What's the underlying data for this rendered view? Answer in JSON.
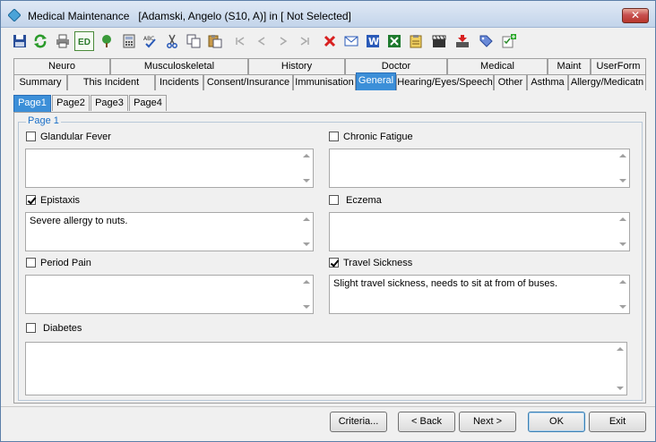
{
  "window": {
    "title": "Medical Maintenance",
    "subtitle": "[Adamski, Angelo (S10, A)] in [ Not Selected]",
    "close_label": "✕"
  },
  "toolbar": {
    "items": [
      {
        "name": "save-icon"
      },
      {
        "name": "refresh-icon"
      },
      {
        "name": "print-icon"
      },
      {
        "name": "ed-icon",
        "label": "ED"
      },
      {
        "name": "tree-icon"
      },
      {
        "name": "calculator-icon"
      },
      {
        "name": "spellcheck-icon",
        "label": "ABC"
      },
      {
        "name": "cut-icon"
      },
      {
        "name": "copy-icon"
      },
      {
        "name": "paste-icon"
      },
      {
        "name": "first-record-icon"
      },
      {
        "name": "previous-record-icon"
      },
      {
        "name": "next-record-icon"
      },
      {
        "name": "last-record-icon"
      },
      {
        "name": "delete-icon"
      },
      {
        "name": "email-icon"
      },
      {
        "name": "word-icon",
        "label": "W"
      },
      {
        "name": "excel-icon"
      },
      {
        "name": "notes-icon"
      },
      {
        "name": "clapper-icon"
      },
      {
        "name": "import-icon"
      },
      {
        "name": "tag-icon"
      },
      {
        "name": "checklist-add-icon"
      }
    ]
  },
  "tabs_row1": [
    "Neuro",
    "Musculoskeletal",
    "History",
    "Doctor",
    "Medical",
    "Maint",
    "UserForm"
  ],
  "tabs_row2": [
    "Summary",
    "This Incident",
    "Incidents",
    "Consent/Insurance",
    "Immunisation",
    "General",
    "Hearing/Eyes/Speech",
    "Other",
    "Asthma",
    "Allergy/Medicatn"
  ],
  "tabs_row3": [
    "Page1",
    "Page2",
    "Page3",
    "Page4"
  ],
  "page_group_label": "Page 1",
  "fields": {
    "glandular_fever": {
      "label": "Glandular Fever",
      "checked": false,
      "value": ""
    },
    "chronic_fatigue": {
      "label": "Chronic Fatigue",
      "checked": false,
      "value": ""
    },
    "epistaxis": {
      "label": "Epistaxis",
      "checked": true,
      "value": "Severe allergy to nuts."
    },
    "eczema": {
      "label": "Eczema",
      "checked": false,
      "value": ""
    },
    "period_pain": {
      "label": "Period Pain",
      "checked": false,
      "value": ""
    },
    "travel_sickness": {
      "label": "Travel Sickness",
      "checked": true,
      "value": "Slight travel sickness, needs to sit at from of buses."
    },
    "diabetes": {
      "label": "Diabetes",
      "checked": false,
      "value": ""
    }
  },
  "buttons": {
    "criteria": "Criteria...",
    "back": "< Back",
    "next": "Next >",
    "ok": "OK",
    "exit": "Exit"
  }
}
